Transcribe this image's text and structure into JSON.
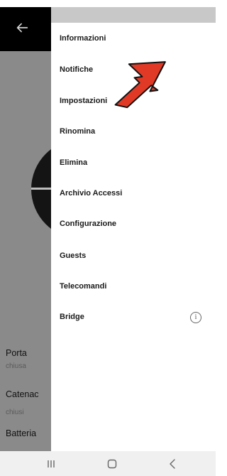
{
  "background_app": {
    "rows": [
      {
        "label": "Porta",
        "value": "chiusa"
      },
      {
        "label": "Catenac",
        "value": "chiusi"
      },
      {
        "label": "Batteria",
        "value": ""
      }
    ]
  },
  "drawer": {
    "items": [
      {
        "label": "Informazioni"
      },
      {
        "label": "Notifiche"
      },
      {
        "label": "Impostazioni"
      },
      {
        "label": "Rinomina"
      },
      {
        "label": "Elimina"
      },
      {
        "label": "Archivio Accessi"
      },
      {
        "label": "Configurazione"
      },
      {
        "label": "Guests"
      },
      {
        "label": "Telecomandi"
      },
      {
        "label": "Bridge"
      }
    ],
    "bridge_info_glyph": "i"
  },
  "annotation": {
    "color": "#e03a26"
  },
  "icons": [
    "back-arrow-icon",
    "info-icon",
    "recents-icon",
    "home-icon",
    "back-icon"
  ]
}
